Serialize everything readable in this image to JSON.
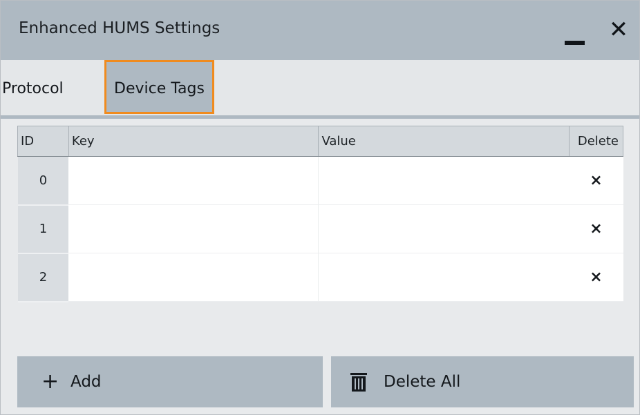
{
  "window": {
    "title": "Enhanced HUMS Settings",
    "minimize_icon": "minimize-icon",
    "close_icon": "close-icon",
    "close_glyph": "✕"
  },
  "tabs": [
    {
      "label": "Protocol",
      "selected": false
    },
    {
      "label": "Device Tags",
      "selected": true
    }
  ],
  "table": {
    "headers": {
      "id": "ID",
      "key": "Key",
      "value": "Value",
      "delete": "Delete"
    },
    "rows": [
      {
        "id": "0",
        "key": "",
        "value": "",
        "delete_glyph": "×"
      },
      {
        "id": "1",
        "key": "",
        "value": "",
        "delete_glyph": "×"
      },
      {
        "id": "2",
        "key": "",
        "value": "",
        "delete_glyph": "×"
      }
    ]
  },
  "buttons": {
    "add_glyph": "+",
    "add_label": "Add",
    "delete_all_label": "Delete All",
    "delete_all_icon": "trash-icon"
  },
  "colors": {
    "title_bar": "#aeb9c2",
    "selected_tab_border": "#f08b1e",
    "background": "#e8eaec"
  }
}
